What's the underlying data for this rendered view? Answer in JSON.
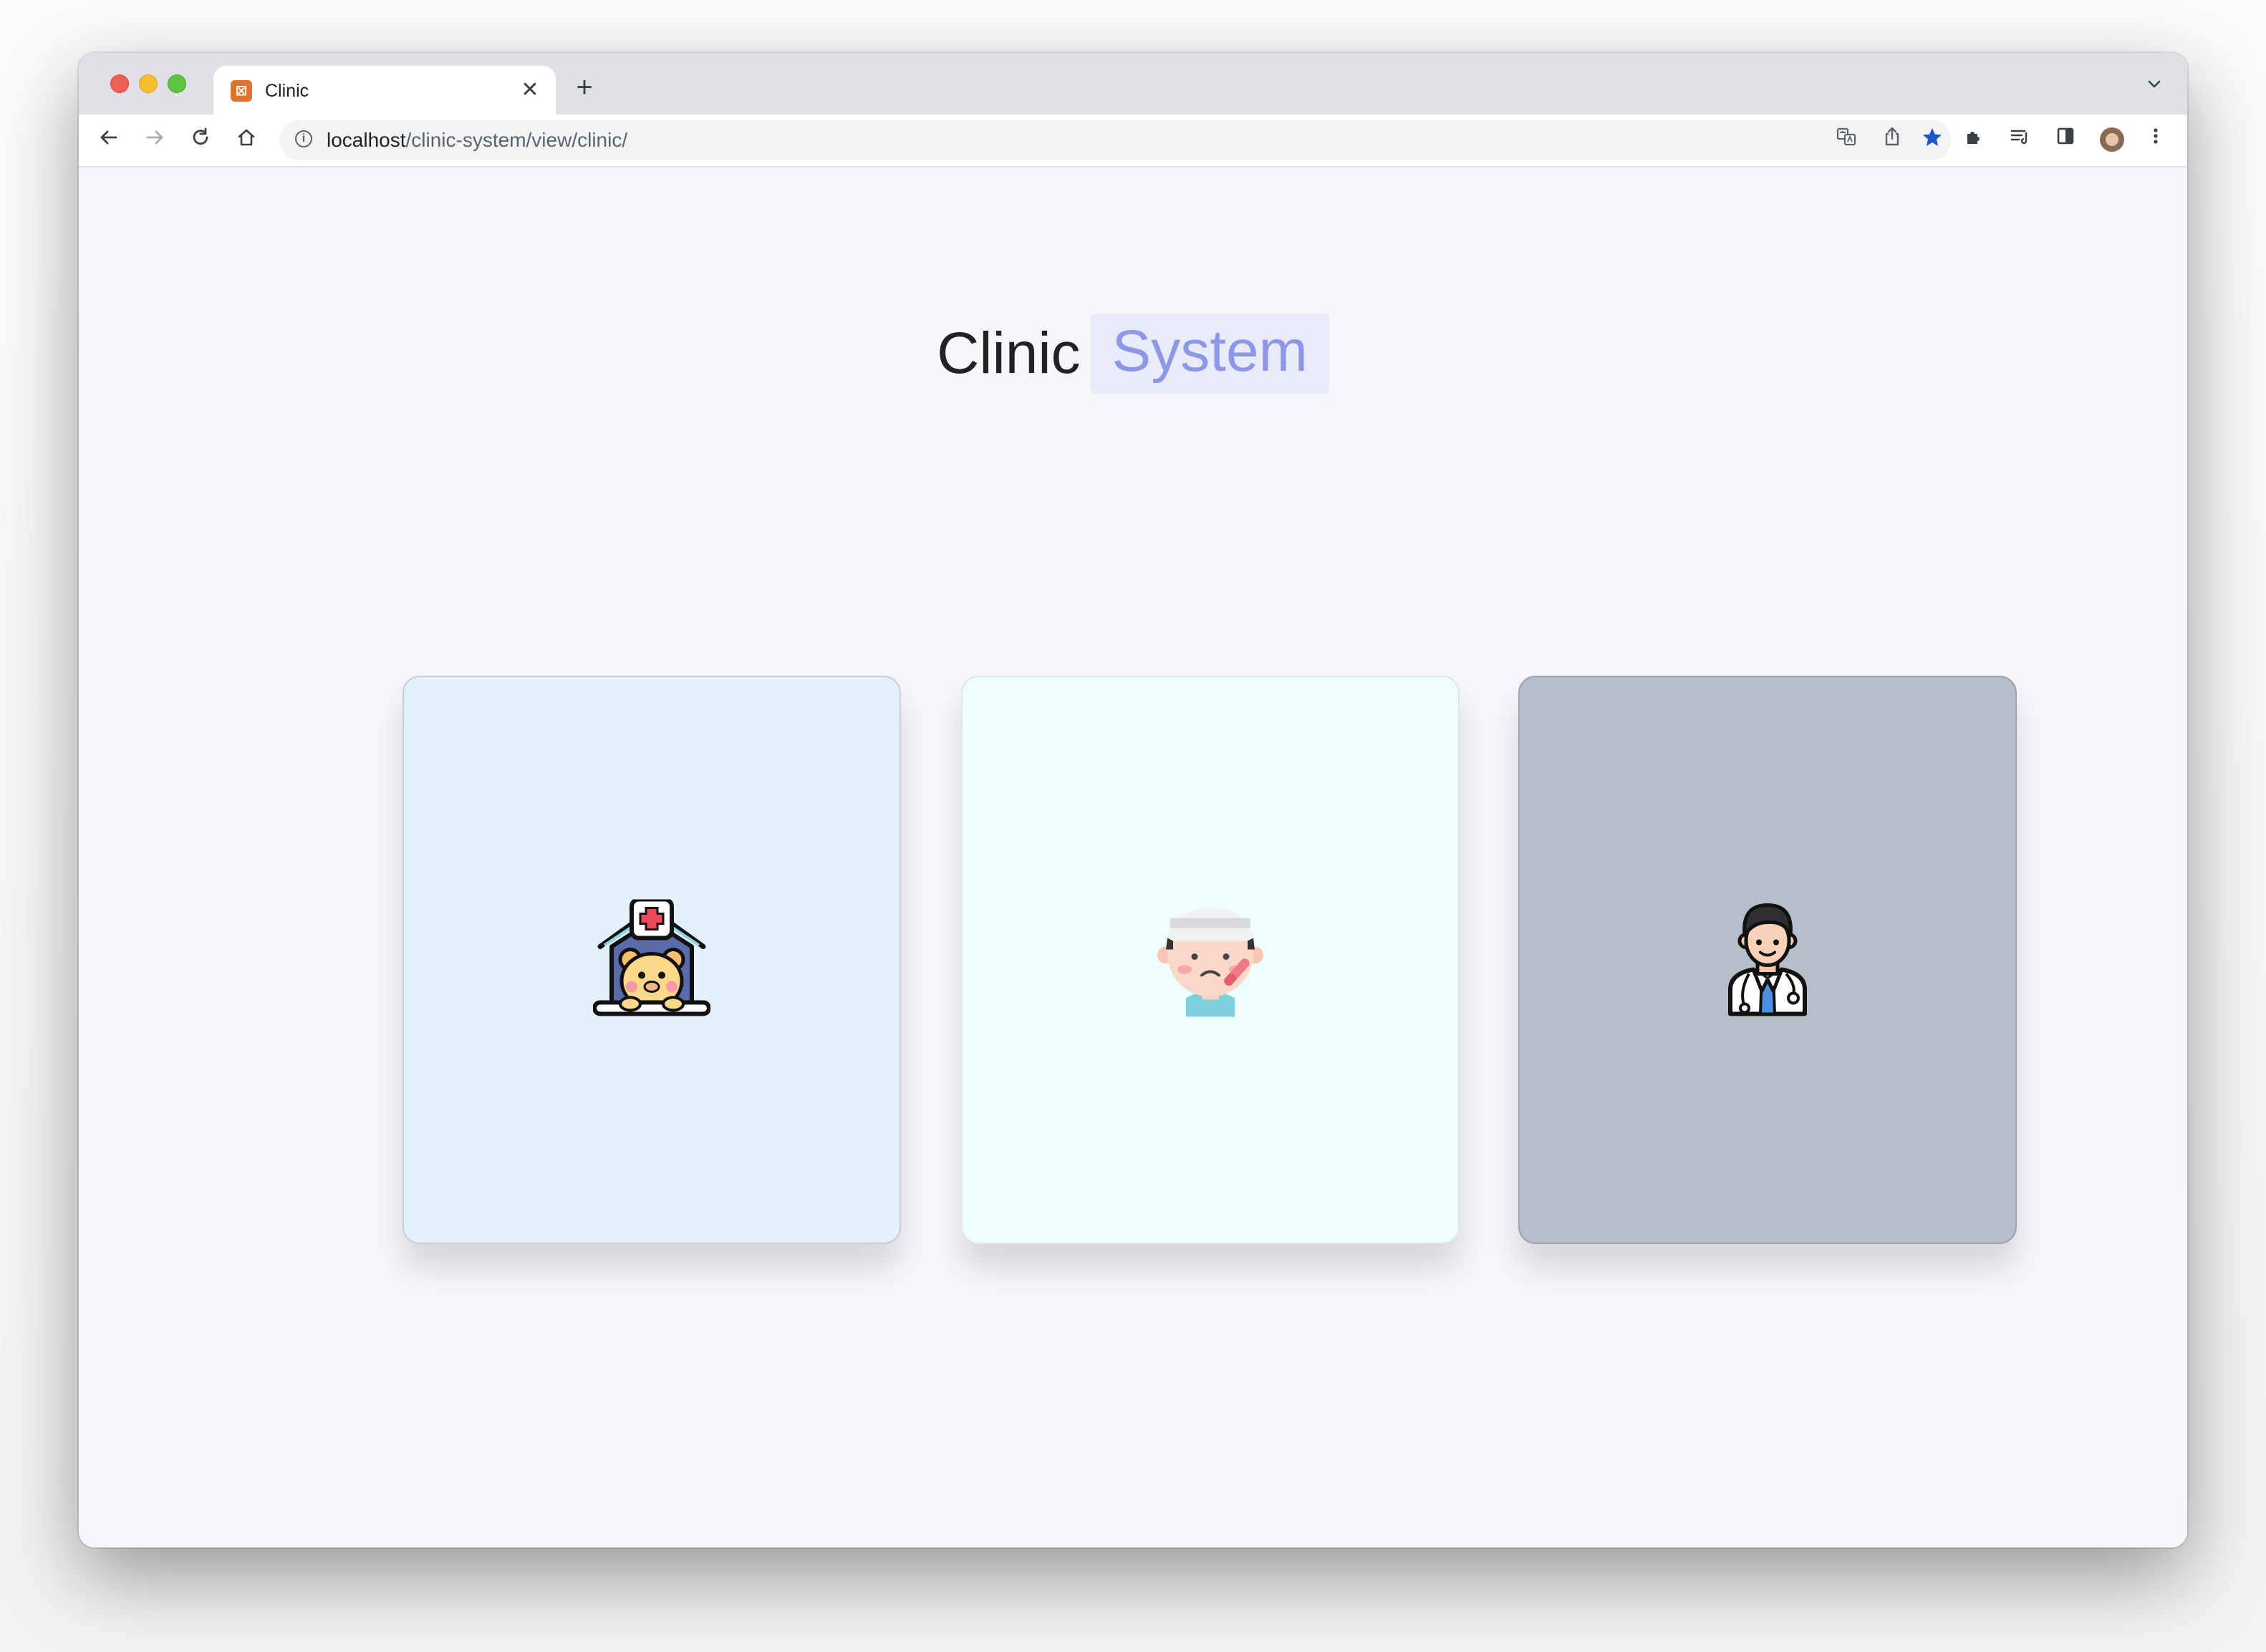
{
  "browser": {
    "tab": {
      "title": "Clinic",
      "favicon": "clinic-favicon",
      "close_glyph": "✕"
    },
    "new_tab_glyph": "+",
    "tabs_menu_glyph": "⌄",
    "nav": {
      "back": "←",
      "forward": "→",
      "reload": "↻",
      "home": "⌂"
    },
    "address": {
      "host": "localhost",
      "path": "/clinic-system/view/clinic/",
      "info_glyph": "i"
    },
    "omnibox_icons": [
      "translate-icon",
      "share-icon",
      "bookmark-star-icon"
    ],
    "toolbar_icons": [
      "extensions-icon",
      "reading-list-icon",
      "side-panel-icon",
      "profile-avatar",
      "more-menu-icon"
    ]
  },
  "page": {
    "heading_word": "Clinic",
    "heading_accent": "System"
  },
  "cards": [
    {
      "name": "clinic-card",
      "icon": "pet-clinic-house-icon",
      "background": "#e4f0fb"
    },
    {
      "name": "patient-card",
      "icon": "sick-patient-icon",
      "background": "#eefdfd"
    },
    {
      "name": "doctor-card",
      "icon": "doctor-icon",
      "background": "#b5bec9"
    }
  ],
  "colors": {
    "accent_text": "#8d97e8",
    "accent_bg": "#eaebf8",
    "bookmark_star": "#1a56c4"
  }
}
